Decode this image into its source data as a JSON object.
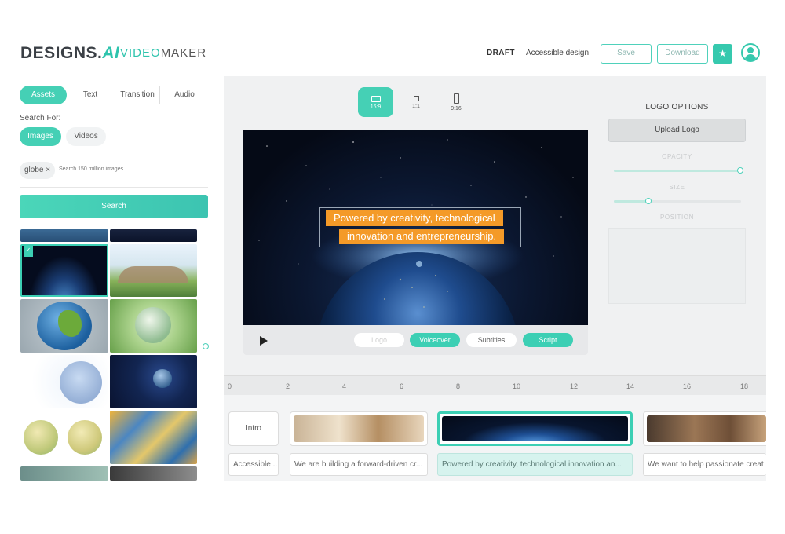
{
  "header": {
    "brand": "DESIGNS.",
    "brand_ai": "AI",
    "product_prefix": "VIDEO",
    "product_suffix": "MAKER",
    "status": "DRAFT",
    "project_name": "Accessible design",
    "save_label": "Save",
    "download_label": "Download",
    "star_icon": "star-icon",
    "accent_color": "#36c9ae"
  },
  "left_panel": {
    "tabs": [
      {
        "label": "Assets",
        "active": true
      },
      {
        "label": "Text",
        "active": false
      },
      {
        "label": "Transition",
        "active": false
      },
      {
        "label": "Audio",
        "active": false
      }
    ],
    "search_for_label": "Search For:",
    "filters": [
      {
        "label": "Images",
        "active": true
      },
      {
        "label": "Videos",
        "active": false
      }
    ],
    "search_chip": "globe",
    "search_chip_close": "×",
    "search_placeholder": "Search 150 million images",
    "search_button": "Search",
    "selected_thumbnail": 2
  },
  "editor": {
    "aspect_ratios": [
      {
        "label": "16:9",
        "active": true
      },
      {
        "label": "1:1",
        "active": false
      },
      {
        "label": "9:16",
        "active": false
      }
    ],
    "caption_line1": "Powered by creativity, technological",
    "caption_line2": "innovation and entrepreneurship.",
    "controls": {
      "play_icon": "play-icon",
      "logo": "Logo",
      "voiceover": "Voiceover",
      "subtitles": "Subtitles",
      "script": "Script"
    }
  },
  "logo_options": {
    "title": "LOGO OPTIONS",
    "upload_label": "Upload Logo",
    "opacity_label": "OPACITY",
    "opacity_value": 1.0,
    "size_label": "SIZE",
    "size_value": 0.27,
    "position_label": "POSITION"
  },
  "timeline": {
    "ticks": [
      "0",
      "2",
      "4",
      "6",
      "8",
      "10",
      "12",
      "14",
      "16",
      "18"
    ],
    "scenes": [
      {
        "label": "Intro",
        "caption": "Accessible ..."
      },
      {
        "label": "",
        "caption": "We are building a forward-driven cr..."
      },
      {
        "label": "",
        "caption": "Powered by creativity, technological innovation an...",
        "active": true
      },
      {
        "label": "",
        "caption": "We want to help passionate creat"
      }
    ]
  }
}
